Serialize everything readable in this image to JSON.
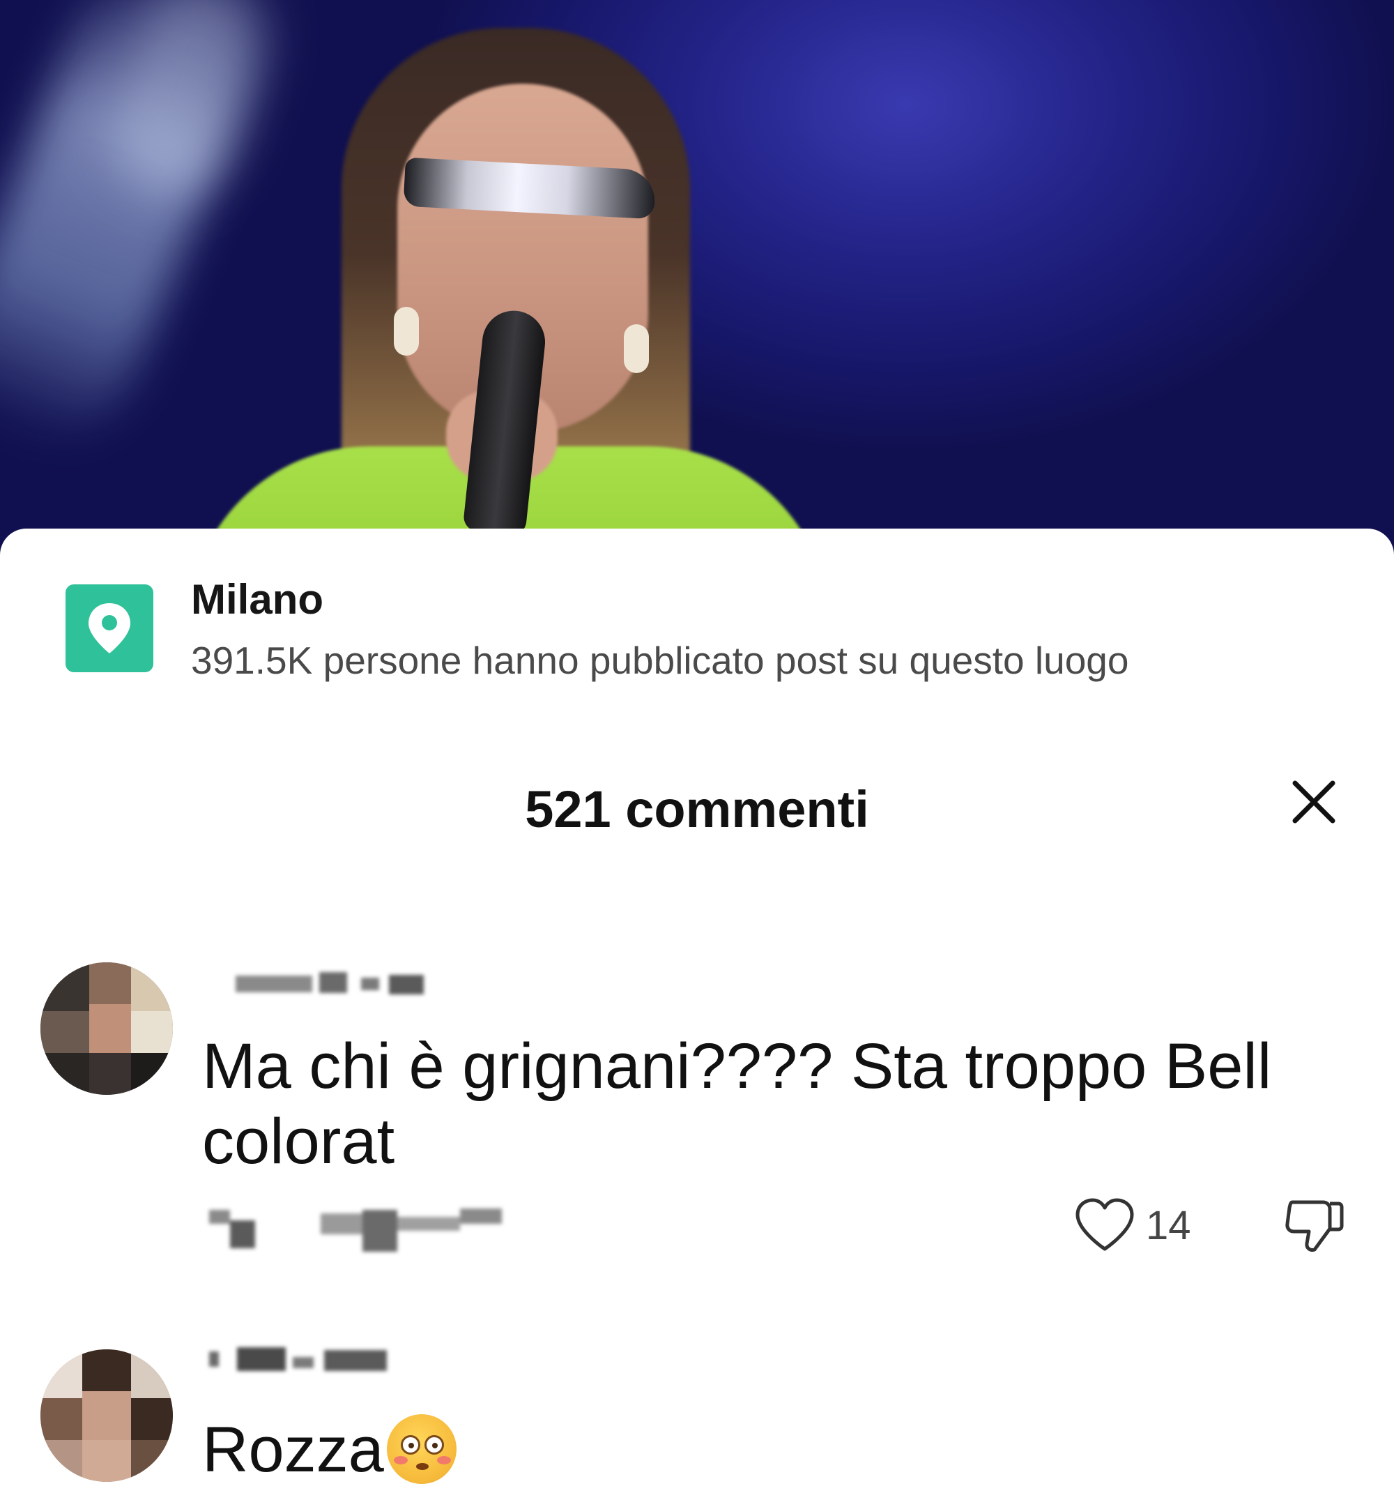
{
  "location": {
    "name": "Milano",
    "subtitle": "391.5K persone hanno pubblicato post su questo luogo",
    "icon": "location-pin-icon",
    "icon_color": "#2fc199"
  },
  "comments_header": {
    "title": "521 commenti",
    "close_icon": "close-icon"
  },
  "comments": [
    {
      "text": "Ma chi è grignani???? Sta troppo Bell colorat",
      "likes": "14",
      "like_icon": "heart-outline-icon",
      "dislike_icon": "thumbs-down-icon"
    },
    {
      "text": "Rozza",
      "emoji": "flushed-face-emoji"
    }
  ]
}
